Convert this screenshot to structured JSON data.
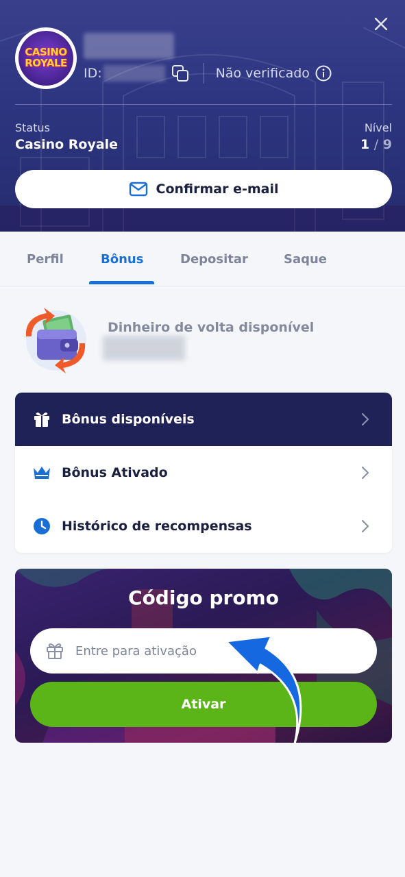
{
  "header": {
    "logo_line1": "CASINO",
    "logo_line2": "ROYALE",
    "id_label": "ID:",
    "verification_status": "Não verificado",
    "status_label": "Status",
    "status_value": "Casino Royale",
    "level_label": "Nível",
    "level_current": "1",
    "level_separator": "/",
    "level_max": "9",
    "confirm_email_label": "Confirmar e-mail",
    "icons": [
      "close-icon",
      "copy-icon",
      "info-icon",
      "mail-icon"
    ]
  },
  "tabs": [
    {
      "label": "Perfil",
      "active": false
    },
    {
      "label": "Bônus",
      "active": true
    },
    {
      "label": "Depositar",
      "active": false
    },
    {
      "label": "Saque",
      "active": false
    }
  ],
  "cashback": {
    "label": "Dinheiro de volta disponível",
    "icon": "wallet-cashback-icon"
  },
  "menu": [
    {
      "label": "Bônus disponíveis",
      "icon": "gift-icon",
      "active": true
    },
    {
      "label": "Bônus Ativado",
      "icon": "crown-icon",
      "active": false
    },
    {
      "label": "Histórico de recompensas",
      "icon": "clock-icon",
      "active": false
    }
  ],
  "promo": {
    "title": "Código promo",
    "input_placeholder": "Entre para ativação",
    "input_value": "",
    "activate_label": "Ativar"
  },
  "colors": {
    "accent_blue": "#1a6fd6",
    "header_bg": "#2d3580",
    "menu_active_bg": "#1f2256",
    "activate_green": "#5cb518",
    "arrow_blue": "#1668e0"
  }
}
